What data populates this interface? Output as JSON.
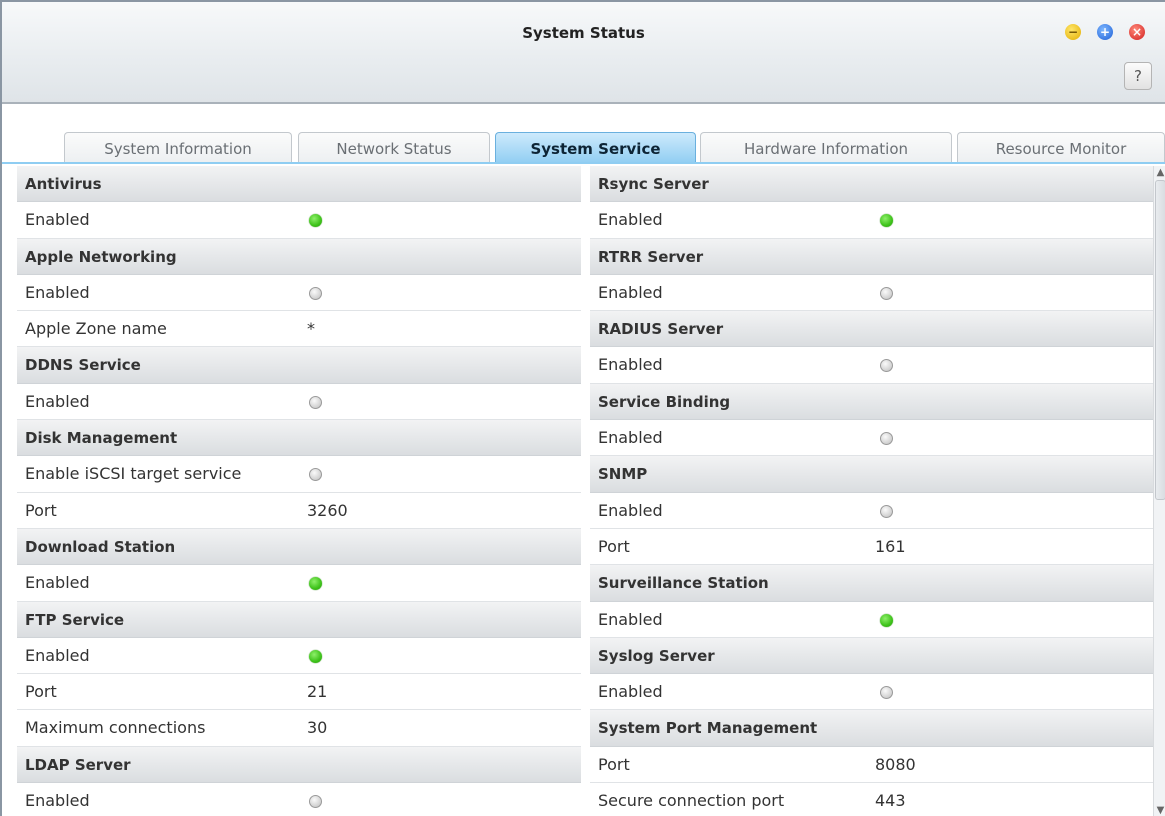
{
  "window": {
    "title": "System Status",
    "help_label": "?"
  },
  "tabs": [
    {
      "label": "System Information",
      "active": false
    },
    {
      "label": "Network Status",
      "active": false
    },
    {
      "label": "System Service",
      "active": true
    },
    {
      "label": "Hardware Information",
      "active": false
    },
    {
      "label": "Resource Monitor",
      "active": false
    }
  ],
  "left_column": [
    {
      "type": "header",
      "label": "Antivirus"
    },
    {
      "type": "status",
      "label": "Enabled",
      "status": "on"
    },
    {
      "type": "header",
      "label": "Apple Networking"
    },
    {
      "type": "status",
      "label": "Enabled",
      "status": "off"
    },
    {
      "type": "value",
      "label": "Apple Zone name",
      "value": "*"
    },
    {
      "type": "header",
      "label": "DDNS Service"
    },
    {
      "type": "status",
      "label": "Enabled",
      "status": "off"
    },
    {
      "type": "header",
      "label": "Disk Management"
    },
    {
      "type": "status",
      "label": "Enable iSCSI target service",
      "status": "off"
    },
    {
      "type": "value",
      "label": "Port",
      "value": "3260"
    },
    {
      "type": "header",
      "label": "Download Station"
    },
    {
      "type": "status",
      "label": "Enabled",
      "status": "on"
    },
    {
      "type": "header",
      "label": "FTP Service"
    },
    {
      "type": "status",
      "label": "Enabled",
      "status": "on"
    },
    {
      "type": "value",
      "label": "Port",
      "value": "21"
    },
    {
      "type": "value",
      "label": "Maximum connections",
      "value": "30"
    },
    {
      "type": "header",
      "label": "LDAP Server"
    },
    {
      "type": "status",
      "label": "Enabled",
      "status": "off"
    }
  ],
  "right_column": [
    {
      "type": "header",
      "label": "Rsync Server"
    },
    {
      "type": "status",
      "label": "Enabled",
      "status": "on"
    },
    {
      "type": "header",
      "label": "RTRR Server"
    },
    {
      "type": "status",
      "label": "Enabled",
      "status": "off"
    },
    {
      "type": "header",
      "label": "RADIUS Server"
    },
    {
      "type": "status",
      "label": "Enabled",
      "status": "off"
    },
    {
      "type": "header",
      "label": "Service Binding"
    },
    {
      "type": "status",
      "label": "Enabled",
      "status": "off"
    },
    {
      "type": "header",
      "label": "SNMP"
    },
    {
      "type": "status",
      "label": "Enabled",
      "status": "off"
    },
    {
      "type": "value",
      "label": "Port",
      "value": "161"
    },
    {
      "type": "header",
      "label": "Surveillance Station"
    },
    {
      "type": "status",
      "label": "Enabled",
      "status": "on"
    },
    {
      "type": "header",
      "label": "Syslog Server"
    },
    {
      "type": "status",
      "label": "Enabled",
      "status": "off"
    },
    {
      "type": "header",
      "label": "System Port Management"
    },
    {
      "type": "value",
      "label": "Port",
      "value": "8080"
    },
    {
      "type": "value",
      "label": "Secure connection port",
      "value": "443"
    }
  ],
  "colors": {
    "active_tab": "#8fcdf2",
    "status_on": "#3ec21a",
    "status_off": "#c8c8c8"
  },
  "icons": {
    "minimize": "minimize-icon",
    "maximize": "maximize-icon",
    "close": "close-icon",
    "help": "help-icon",
    "status_on": "green-dot-icon",
    "status_off": "gray-dot-icon"
  }
}
